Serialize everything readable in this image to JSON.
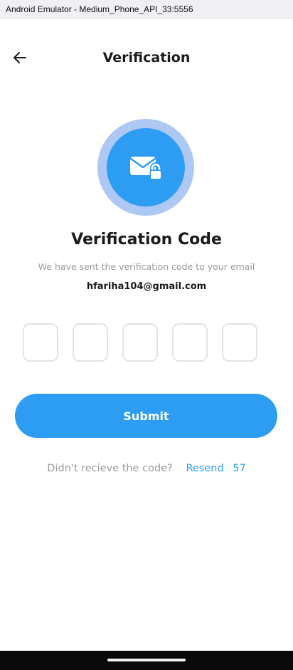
{
  "window": {
    "title": "Android Emulator - Medium_Phone_API_33:5556"
  },
  "header": {
    "back_icon": "arrow-left-icon",
    "title": "Verification"
  },
  "illustration": {
    "icon": "mail-lock-icon",
    "outer_color": "#aec8f4",
    "inner_color": "#2d9cf3"
  },
  "content": {
    "heading": "Verification Code",
    "subtitle": "We have sent the verification code to your email",
    "email": "hfariha104@gmail.com"
  },
  "otp": {
    "length": 5,
    "values": [
      "",
      "",
      "",
      "",
      ""
    ]
  },
  "submit": {
    "label": "Submit",
    "color": "#2d9cf3"
  },
  "resend": {
    "prompt": "Didn't recieve the code?",
    "link_label": "Resend",
    "countdown": "57"
  }
}
